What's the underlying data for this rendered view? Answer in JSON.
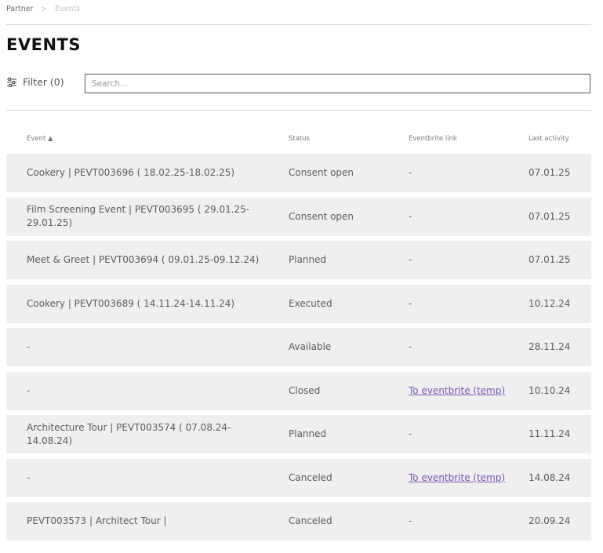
{
  "breadcrumb": {
    "parent": "Partner",
    "separator": ">",
    "current": "Events"
  },
  "page": {
    "title": "EVENTS"
  },
  "toolbar": {
    "filter_label": "Filter (0)",
    "search_placeholder": "Search..."
  },
  "table": {
    "headers": {
      "event": "Event ▲",
      "status": "Status",
      "eventbrite_link": "Eventbrite link",
      "last_activity": "Last activity"
    },
    "rows": [
      {
        "event": "Cookery | PEVT003696 ( 18.02.25-18.02.25)",
        "status": "Consent open",
        "link": "-",
        "last": "07.01.25"
      },
      {
        "event": "Film Screening Event | PEVT003695 ( 29.01.25-29.01.25)",
        "status": "Consent open",
        "link": "-",
        "last": "07.01.25"
      },
      {
        "event": "Meet & Greet | PEVT003694 ( 09.01.25-09.12.24)",
        "status": "Planned",
        "link": "-",
        "last": "07.01.25"
      },
      {
        "event": "Cookery | PEVT003689 ( 14.11.24-14.11.24)",
        "status": "Executed",
        "link": "-",
        "last": "10.12.24"
      },
      {
        "event": "-",
        "status": "Available",
        "link": "-",
        "last": "28.11.24"
      },
      {
        "event": "-",
        "status": "Closed",
        "link": "To eventbrite (temp)",
        "last": "10.10.24"
      },
      {
        "event": "Architecture Tour | PEVT003574 ( 07.08.24-14.08.24)",
        "status": "Planned",
        "link": "-",
        "last": "11.11.24"
      },
      {
        "event": "-",
        "status": "Canceled",
        "link": "To eventbrite (temp)",
        "last": "14.08.24"
      },
      {
        "event": "PEVT003573 | Architect Tour |",
        "status": "Canceled",
        "link": "-",
        "last": "20.09.24"
      }
    ]
  }
}
